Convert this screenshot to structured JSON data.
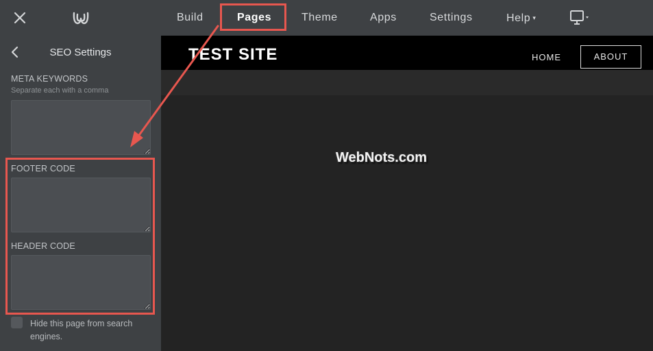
{
  "topbar": {
    "nav": [
      {
        "label": "Build"
      },
      {
        "label": "Pages"
      },
      {
        "label": "Theme"
      },
      {
        "label": "Apps"
      },
      {
        "label": "Settings"
      },
      {
        "label": "Help"
      }
    ],
    "active_tab": "Pages",
    "icons": {
      "close": "close-icon",
      "logo": "weebly-logo-icon",
      "device": "desktop-monitor-icon"
    }
  },
  "sidebar": {
    "title": "SEO Settings",
    "meta_keywords": {
      "label": "META KEYWORDS",
      "hint": "Separate each with a comma",
      "value": ""
    },
    "footer_code": {
      "label": "FOOTER CODE",
      "value": ""
    },
    "header_code": {
      "label": "HEADER CODE",
      "value": ""
    },
    "hide_page": {
      "label": "Hide this page from search engines.",
      "checked": false
    }
  },
  "preview": {
    "site_title": "TEST SITE",
    "nav": [
      {
        "label": "HOME"
      },
      {
        "label": "ABOUT"
      }
    ],
    "watermark": "WebNots.com"
  },
  "colors": {
    "chrome": "#3e4144",
    "preview_bg": "#232323",
    "site_header": "#000000",
    "annotation": "#e8574f",
    "field_bg": "#4b4e52"
  }
}
